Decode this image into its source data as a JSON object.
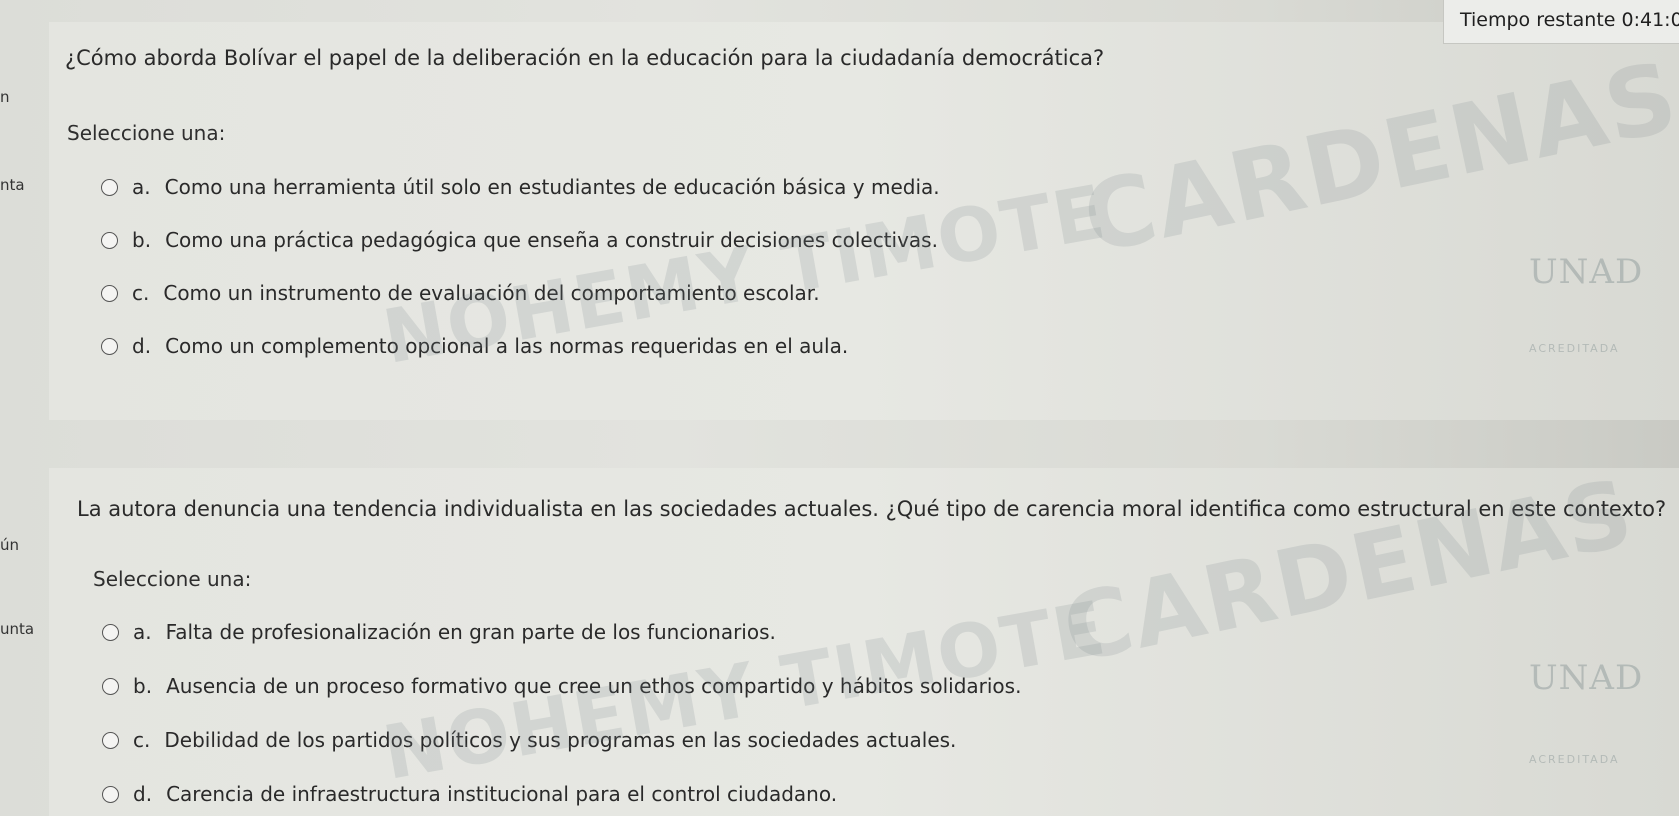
{
  "timer": {
    "label": "Tiempo restante 0:41:0"
  },
  "sidebar_fragments": [
    "n",
    "nta",
    "ún",
    "unta"
  ],
  "questions": [
    {
      "text": "¿Cómo aborda Bolívar el papel de la deliberación en la educación para la ciudadanía democrática?",
      "select_label": "Seleccione una:",
      "options": [
        {
          "letter": "a.",
          "text": "Como una herramienta útil solo en estudiantes de educación básica y media."
        },
        {
          "letter": "b.",
          "text": "Como una práctica pedagógica que enseña a construir decisiones colectivas."
        },
        {
          "letter": "c.",
          "text": "Como un instrumento de evaluación del comportamiento escolar."
        },
        {
          "letter": "d.",
          "text": "Como un complemento opcional a las normas requeridas en el aula."
        }
      ]
    },
    {
      "text": "La autora denuncia una tendencia individualista en las sociedades actuales. ¿Qué tipo de carencia moral identifica como estructural en este contexto?",
      "select_label": "Seleccione una:",
      "options": [
        {
          "letter": "a.",
          "text": "Falta de profesionalización en gran parte de los funcionarios."
        },
        {
          "letter": "b.",
          "text": "Ausencia de un proceso formativo que cree un ethos compartido y hábitos solidarios."
        },
        {
          "letter": "c.",
          "text": "Debilidad de los partidos políticos y sus programas en las sociedades actuales."
        },
        {
          "letter": "d.",
          "text": "Carencia de infraestructura institucional para el control ciudadano."
        }
      ]
    }
  ],
  "watermark": {
    "line1": "CARDENAS",
    "line2": "NOHEMY TIMOTE",
    "logo": "UNAD",
    "logo_sub": "ACREDITADA"
  }
}
